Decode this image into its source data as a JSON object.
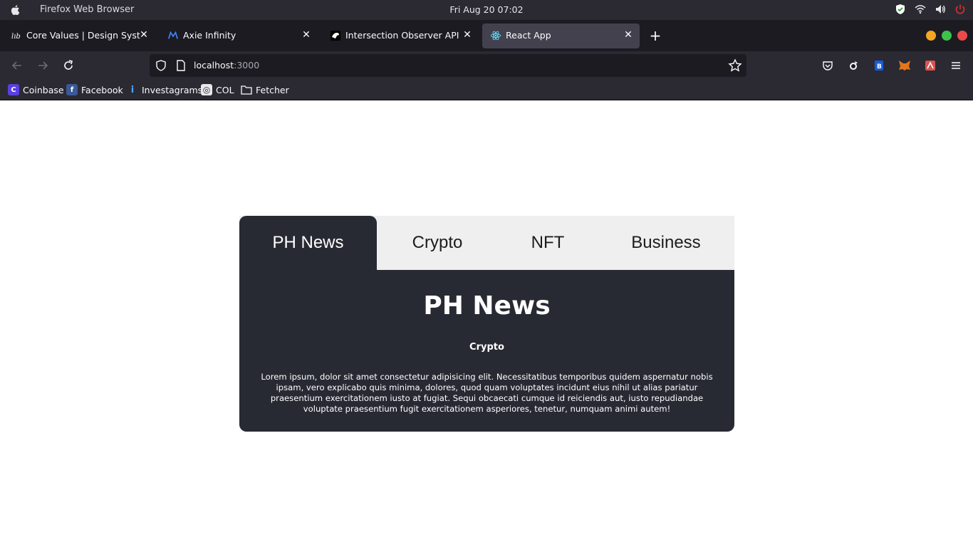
{
  "system_bar": {
    "app_name": "Firefox Web Browser",
    "clock": "Fri Aug 20  07:02"
  },
  "tabs": [
    {
      "label": "Core Values | Design System of",
      "icon": "design-system-icon"
    },
    {
      "label": "Axie Infinity",
      "icon": "axie-icon"
    },
    {
      "label": "Intersection Observer API - We",
      "icon": "mdn-icon"
    },
    {
      "label": "React App",
      "icon": "react-icon",
      "active": true
    }
  ],
  "navbar": {
    "url_host": "localhost",
    "url_port": ":3000"
  },
  "bookmarks": [
    {
      "label": "Coinbase",
      "icon": "coinbase-icon",
      "glyph": "C"
    },
    {
      "label": "Facebook",
      "icon": "facebook-icon",
      "glyph": "f"
    },
    {
      "label": "Investagrams",
      "icon": "investagrams-icon",
      "glyph": "i"
    },
    {
      "label": "COL",
      "icon": "col-icon",
      "glyph": "◎"
    },
    {
      "label": "Fetcher",
      "icon": "folder-icon",
      "glyph": ""
    }
  ],
  "news_app": {
    "tabs": [
      "PH News",
      "Crypto",
      "NFT",
      "Business"
    ],
    "active_tab": "PH News",
    "panel": {
      "title": "PH News",
      "subtitle": "Crypto",
      "body": "Lorem ipsum, dolor sit amet consectetur adipisicing elit. Necessitatibus temporibus quidem aspernatur nobis ipsam, vero explicabo quis minima, dolores, quod quam voluptates incidunt eius nihil ut alias pariatur praesentium exercitationem iusto at fugiat. Sequi obcaecati cumque id reiciendis aut, iusto repudiandae voluptate praesentium fugit exercitationem asperiores, tenetur, numquam animi autem!"
    }
  },
  "colors": {
    "panel_bg": "#282a33",
    "tabs_bg": "#efefef",
    "browser_dark": "#1c1b22",
    "browser_toolbar": "#2b2a33",
    "win_minimize": "#f5a623",
    "win_maximize": "#3fc24a",
    "win_close": "#ec4a4a"
  }
}
